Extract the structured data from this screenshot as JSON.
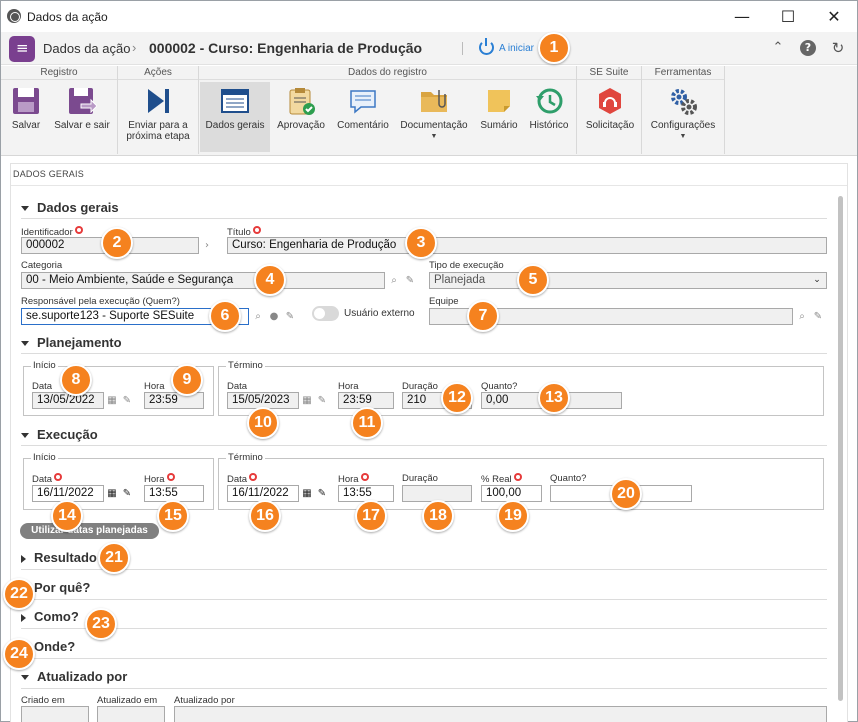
{
  "window": {
    "title": "Dados da ação",
    "minimize": "—",
    "maximize": "☐",
    "close": "✕"
  },
  "header": {
    "breadcrumb": "Dados da ação",
    "separator": "›",
    "title": "000002 - Curso: Engenharia de Produção",
    "status": "A iniciar",
    "icons": [
      "collapse-up-icon",
      "help-icon",
      "refresh-icon"
    ]
  },
  "ribbon": {
    "groups": {
      "registro": "Registro",
      "acoes": "Ações",
      "dados_registro": "Dados do registro",
      "se_suite": "SE Suite",
      "ferramentas": "Ferramentas"
    },
    "buttons": {
      "salvar": "Salvar",
      "salvar_sair": "Salvar e sair",
      "enviar_1": "Enviar para a",
      "enviar_2": "próxima etapa",
      "dados_gerais": "Dados gerais",
      "aprovacao": "Aprovação",
      "comentario": "Comentário",
      "documentacao": "Documentação",
      "sumario": "Sumário",
      "historico": "Histórico",
      "solicitacao": "Solicitação",
      "configuracoes": "Configurações"
    }
  },
  "panel": {
    "title": "DADOS GERAIS"
  },
  "sections": {
    "dados_gerais": "Dados gerais",
    "planejamento": "Planejamento",
    "execucao": "Execução",
    "resultado": "Resultado",
    "por_que": "Por quê?",
    "como": "Como?",
    "onde": "Onde?",
    "atualizado_por": "Atualizado por"
  },
  "fields": {
    "identificador": {
      "label": "Identificador",
      "value": "000002"
    },
    "titulo": {
      "label": "Título",
      "value": "Curso: Engenharia de Produção"
    },
    "categoria": {
      "label": "Categoria",
      "value": "00 - Meio Ambiente, Saúde e Segurança"
    },
    "tipo_execucao": {
      "label": "Tipo de execução",
      "value": "Planejada"
    },
    "responsavel": {
      "label": "Responsável pela execução (Quem?)",
      "value": "se.suporte123 - Suporte SESuite"
    },
    "usuario_externo": {
      "label": "Usuário externo"
    },
    "equipe": {
      "label": "Equipe",
      "value": ""
    }
  },
  "planejamento": {
    "inicio": "Início",
    "termino": "Término",
    "data_label": "Data",
    "hora_label": "Hora",
    "duracao_label": "Duração",
    "quanto_label": "Quanto?",
    "inicio_data": "13/05/2022",
    "inicio_hora": "23:59",
    "termino_data": "15/05/2023",
    "termino_hora": "23:59",
    "duracao": "210",
    "quanto": "0,00"
  },
  "execucao": {
    "inicio": "Início",
    "termino": "Término",
    "data_label": "Data",
    "hora_label": "Hora",
    "duracao_label": "Duração",
    "real_label": "% Real",
    "quanto_label": "Quanto?",
    "inicio_data": "16/11/2022",
    "inicio_hora": "13:55",
    "termino_data": "16/11/2022",
    "termino_hora": "13:55",
    "duracao": "",
    "real": "100,00",
    "quanto": "",
    "usar_planejadas": "Utilizar datas planejadas"
  },
  "atualizado": {
    "criado_em": "Criado em",
    "atualizado_em": "Atualizado em",
    "atualizado_por": "Atualizado por"
  },
  "badges": [
    "1",
    "2",
    "3",
    "4",
    "5",
    "6",
    "7",
    "8",
    "9",
    "10",
    "11",
    "12",
    "13",
    "14",
    "15",
    "16",
    "17",
    "18",
    "19",
    "20",
    "21",
    "22",
    "23",
    "24"
  ],
  "colors": {
    "accent": "#f5821f",
    "brand": "#7a3f8f",
    "link": "#2a7fd4",
    "required": "#e63b3b"
  }
}
